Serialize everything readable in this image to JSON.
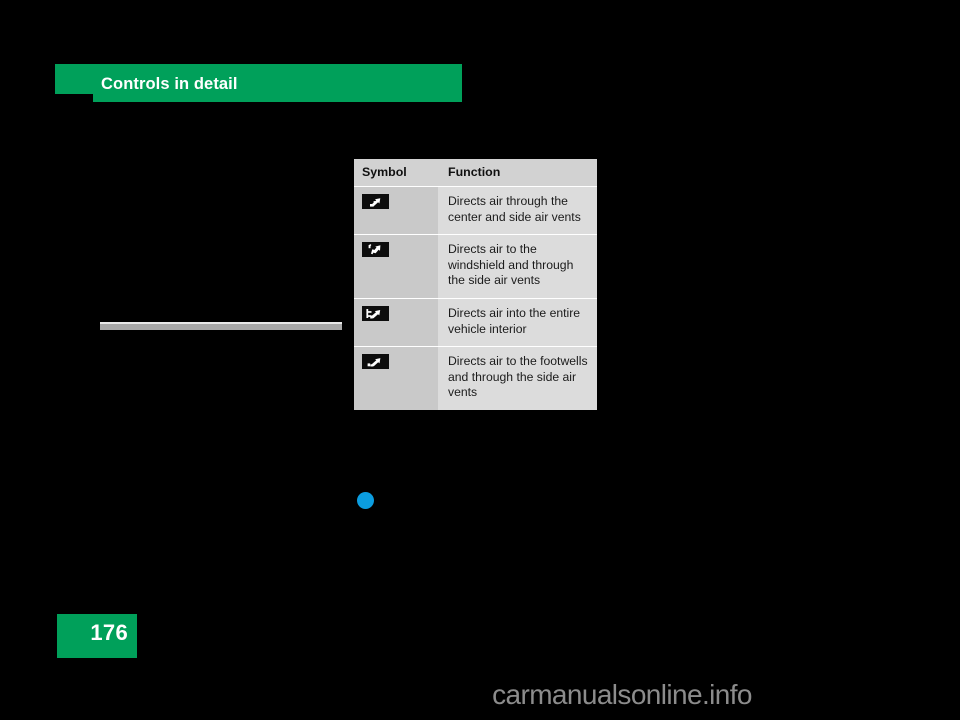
{
  "chapter": {
    "title": "Controls in detail"
  },
  "table": {
    "headers": {
      "symbol": "Symbol",
      "function": "Function"
    },
    "rows": [
      {
        "symbol_icon": "air-vent-center-and-side-icon",
        "function": "Directs air through the center and side air vents"
      },
      {
        "symbol_icon": "air-vent-windshield-and-side-icon",
        "function": "Directs air to the windshield and through the side air vents"
      },
      {
        "symbol_icon": "air-vent-entire-interior-icon",
        "function": "Directs air into the entire vehicle interior"
      },
      {
        "symbol_icon": "air-vent-footwell-and-side-icon",
        "function": "Directs air to the footwells and through the side air vents"
      }
    ]
  },
  "page_number": "176",
  "watermark": "carmanualsonline.info",
  "colors": {
    "brand_green": "#00a05a",
    "bullet_blue": "#0b9de0",
    "table_header_bg": "#d2d2d2",
    "symbol_cell_bg": "#c9c9c9",
    "function_cell_bg": "#dcdcdc",
    "glyph_bg": "#0d0d0d",
    "page_bg": "#000000",
    "watermark_gray": "#8c8c8c"
  }
}
